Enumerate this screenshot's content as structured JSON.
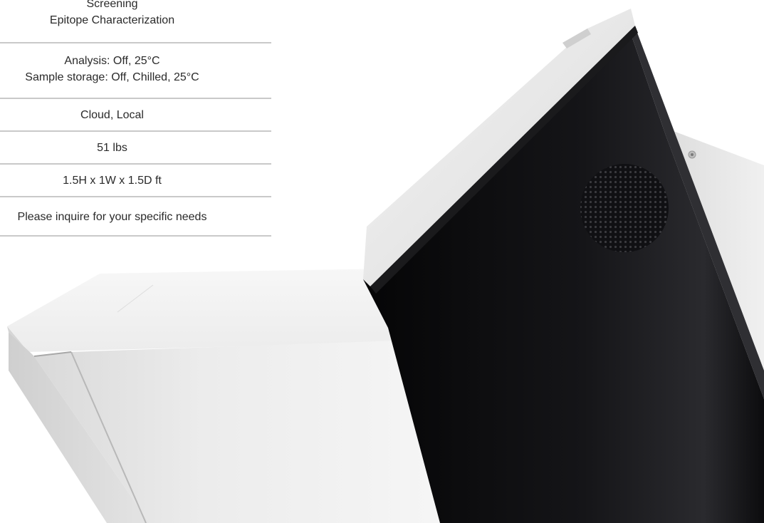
{
  "specs": {
    "uses": [
      "Screening",
      "Epitope Characterization"
    ],
    "temperature": [
      "Analysis: Off, 25°C",
      "Sample storage: Off, Chilled, 25°C"
    ],
    "connectivity": "Cloud, Local",
    "weight": "51 lbs",
    "dimensions": "1.5H x 1W x 1.5D ft",
    "price": "Please inquire for your specific needs"
  },
  "colors": {
    "row_divider": "#c9c9c9",
    "text": "#2a2a2a",
    "device_body": "#0b0b0d",
    "device_shell": "#e6e6e6"
  }
}
